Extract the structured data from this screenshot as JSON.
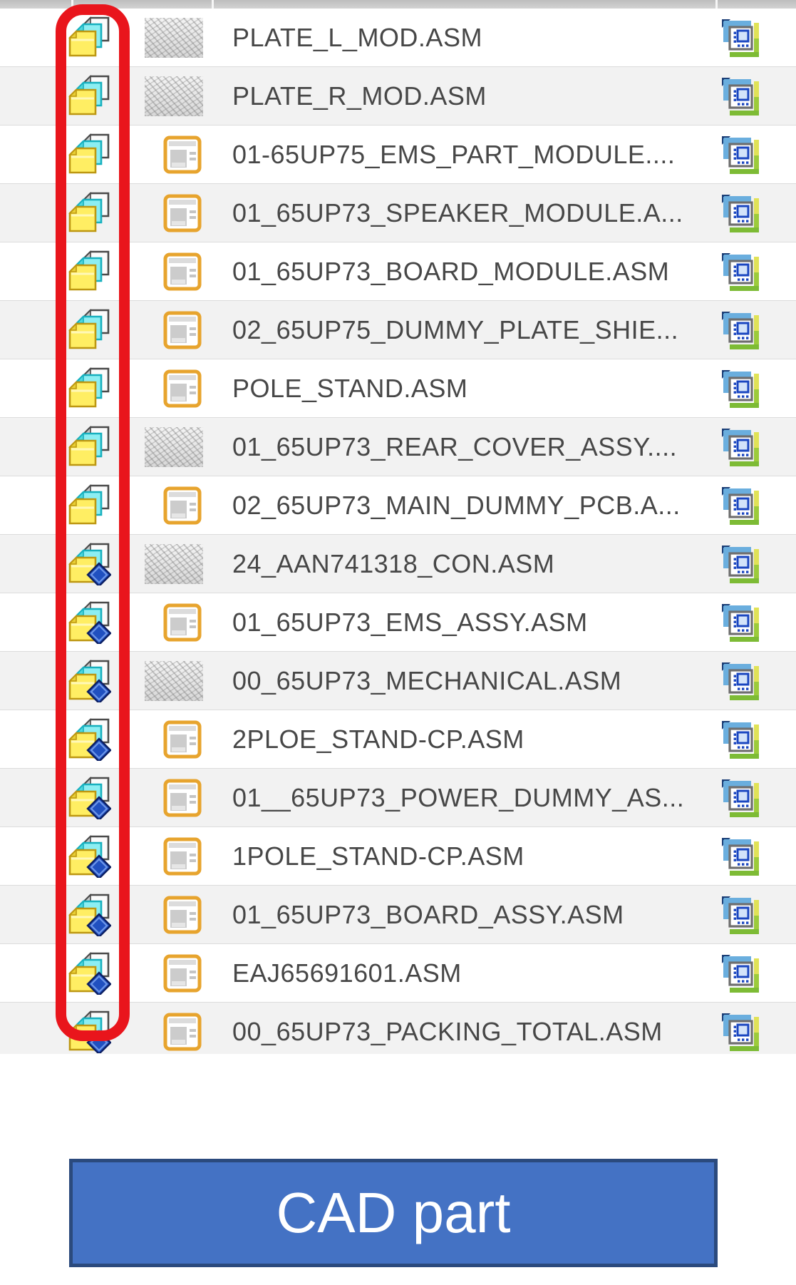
{
  "table": {
    "rows": [
      {
        "file_name": "PLATE_L_MOD.ASM",
        "type_icon": "cad-assembly-stack",
        "has_instance_diamond": false,
        "preview": "thumbnail",
        "action_icon": "open-information"
      },
      {
        "file_name": "PLATE_R_MOD.ASM",
        "type_icon": "cad-assembly-stack",
        "has_instance_diamond": false,
        "preview": "thumbnail",
        "action_icon": "open-information"
      },
      {
        "file_name": "01-65UP75_EMS_PART_MODULE....",
        "type_icon": "cad-assembly-stack",
        "has_instance_diamond": false,
        "preview": "form",
        "action_icon": "open-information"
      },
      {
        "file_name": "01_65UP73_SPEAKER_MODULE.A...",
        "type_icon": "cad-assembly-stack",
        "has_instance_diamond": false,
        "preview": "form",
        "action_icon": "open-information"
      },
      {
        "file_name": "01_65UP73_BOARD_MODULE.ASM",
        "type_icon": "cad-assembly-stack",
        "has_instance_diamond": false,
        "preview": "form",
        "action_icon": "open-information"
      },
      {
        "file_name": "02_65UP75_DUMMY_PLATE_SHIE...",
        "type_icon": "cad-assembly-stack",
        "has_instance_diamond": false,
        "preview": "form",
        "action_icon": "open-information"
      },
      {
        "file_name": "POLE_STAND.ASM",
        "type_icon": "cad-assembly-stack",
        "has_instance_diamond": false,
        "preview": "form",
        "action_icon": "open-information"
      },
      {
        "file_name": "01_65UP73_REAR_COVER_ASSY....",
        "type_icon": "cad-assembly-stack",
        "has_instance_diamond": false,
        "preview": "thumbnail",
        "action_icon": "open-information"
      },
      {
        "file_name": "02_65UP73_MAIN_DUMMY_PCB.A...",
        "type_icon": "cad-assembly-stack",
        "has_instance_diamond": false,
        "preview": "form",
        "action_icon": "open-information"
      },
      {
        "file_name": "24_AAN741318_CON.ASM",
        "type_icon": "cad-assembly-stack",
        "has_instance_diamond": true,
        "preview": "thumbnail",
        "action_icon": "open-information"
      },
      {
        "file_name": "01_65UP73_EMS_ASSY.ASM",
        "type_icon": "cad-assembly-stack",
        "has_instance_diamond": true,
        "preview": "form",
        "action_icon": "open-information"
      },
      {
        "file_name": "00_65UP73_MECHANICAL.ASM",
        "type_icon": "cad-assembly-stack",
        "has_instance_diamond": true,
        "preview": "thumbnail",
        "action_icon": "open-information"
      },
      {
        "file_name": "2PLOE_STAND-CP.ASM",
        "type_icon": "cad-assembly-stack",
        "has_instance_diamond": true,
        "preview": "form",
        "action_icon": "open-information"
      },
      {
        "file_name": "01__65UP73_POWER_DUMMY_AS...",
        "type_icon": "cad-assembly-stack",
        "has_instance_diamond": true,
        "preview": "form",
        "action_icon": "open-information"
      },
      {
        "file_name": "1POLE_STAND-CP.ASM",
        "type_icon": "cad-assembly-stack",
        "has_instance_diamond": true,
        "preview": "form",
        "action_icon": "open-information"
      },
      {
        "file_name": "01_65UP73_BOARD_ASSY.ASM",
        "type_icon": "cad-assembly-stack",
        "has_instance_diamond": true,
        "preview": "form",
        "action_icon": "open-information"
      },
      {
        "file_name": "EAJ65691601.ASM",
        "type_icon": "cad-assembly-stack",
        "has_instance_diamond": true,
        "preview": "form",
        "action_icon": "open-information"
      },
      {
        "file_name": "00_65UP73_PACKING_TOTAL.ASM",
        "type_icon": "cad-assembly-stack",
        "has_instance_diamond": true,
        "preview": "form",
        "action_icon": "open-information"
      }
    ]
  },
  "annotation": {
    "shape": "red-rounded-rectangle",
    "highlights": "cad-type-icon-column",
    "color": "#e9151c"
  },
  "banner": {
    "label": "CAD part",
    "fill": "#4472c4",
    "border_color": "#2b4a7d",
    "text_color": "#ffffff"
  }
}
